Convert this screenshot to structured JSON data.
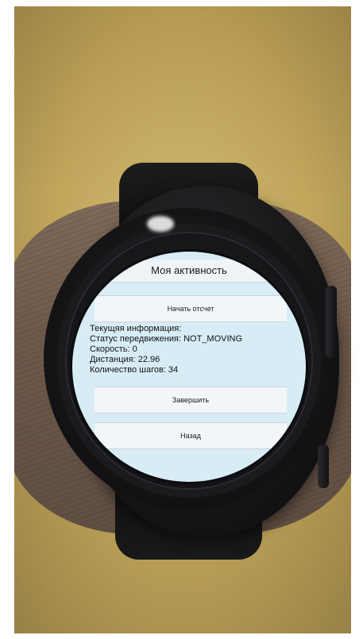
{
  "app": {
    "title": "Моя активность"
  },
  "buttons": {
    "start": "Начать отсчет",
    "finish": "Завершить",
    "back": "Назад"
  },
  "info": {
    "header": "Текущяя информация:",
    "status": "Статус передвижения: NOT_MOVING",
    "speed": "Скорость: 0",
    "distance": "Дистанция: 22.96",
    "steps": "Количество шагов: 34"
  },
  "colors": {
    "screen_background": "#d8ecf6",
    "button_background": "#f2f6f8",
    "wall": "#c2a65c",
    "watch_case": "#151517"
  }
}
